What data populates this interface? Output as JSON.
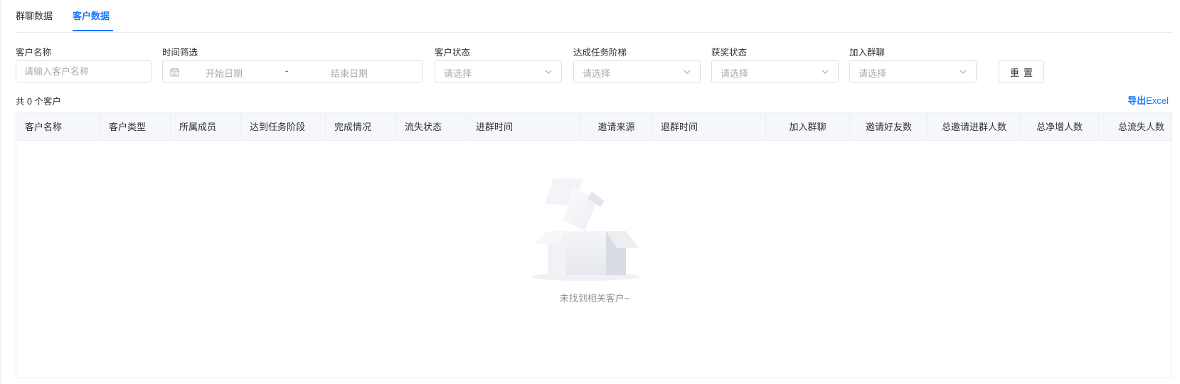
{
  "tabs": [
    {
      "label": "群聊数据"
    },
    {
      "label": "客户数据"
    }
  ],
  "filters": {
    "customer_name": {
      "label": "客户名称",
      "placeholder": "请输入客户名称"
    },
    "time": {
      "label": "时间筛选",
      "start_placeholder": "开始日期",
      "separator": "-",
      "end_placeholder": "结束日期"
    },
    "customer_status": {
      "label": "客户状态",
      "placeholder": "请选择"
    },
    "task_stage": {
      "label": "达成任务阶梯",
      "placeholder": "请选择"
    },
    "award_status": {
      "label": "获奖状态",
      "placeholder": "请选择"
    },
    "group_join": {
      "label": "加入群聊",
      "placeholder": "请选择"
    },
    "reset_label": "重置"
  },
  "summary": {
    "total_text": "共 0 个客户"
  },
  "export": {
    "prefix": "导出",
    "suffix": "Excel"
  },
  "table": {
    "columns": [
      "客户名称",
      "客户类型",
      "所属成员",
      "达到任务阶段",
      "完成情况",
      "流失状态",
      "进群时间",
      "邀请来源",
      "退群时间",
      "加入群聊",
      "邀请好友数",
      "总邀请进群人数",
      "总净增人数",
      "总流失人数"
    ],
    "empty_text": "未找到相关客户~"
  },
  "colors": {
    "accent": "#1677ff",
    "border": "#dcdfe6",
    "header_bg": "#f5f7fa"
  }
}
